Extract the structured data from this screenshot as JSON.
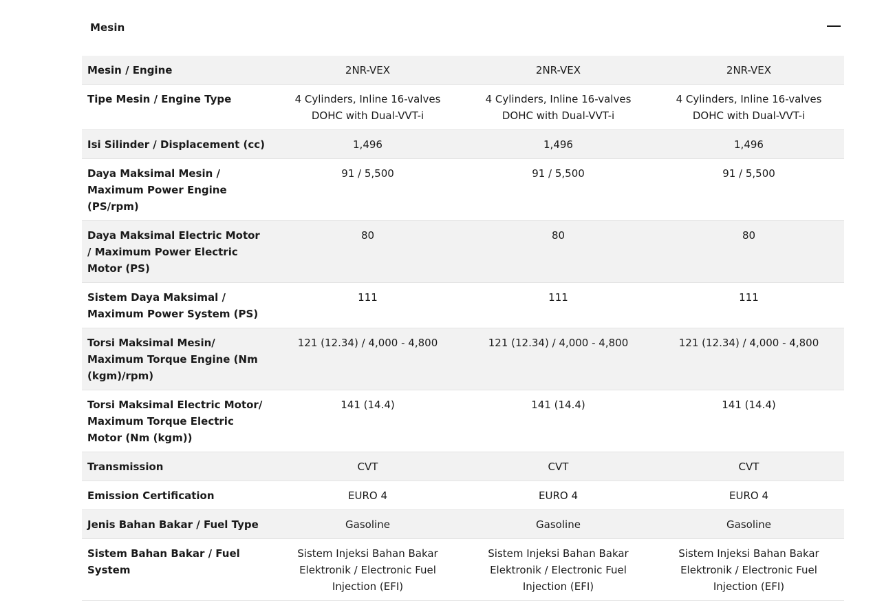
{
  "section": {
    "title": "Mesin",
    "toggle_icon": "minus-icon"
  },
  "rows": [
    {
      "label": "Mesin / Engine",
      "values": [
        "2NR-VEX",
        "2NR-VEX",
        "2NR-VEX"
      ]
    },
    {
      "label": "Tipe Mesin / Engine Type",
      "values": [
        "4 Cylinders, Inline 16-valves DOHC with Dual-VVT-i",
        "4 Cylinders, Inline 16-valves DOHC with Dual-VVT-i",
        "4 Cylinders, Inline 16-valves DOHC with Dual-VVT-i"
      ]
    },
    {
      "label": "Isi Silinder / Displacement (cc)",
      "values": [
        "1,496",
        "1,496",
        "1,496"
      ]
    },
    {
      "label": "Daya Maksimal Mesin / Maximum Power Engine (PS/rpm)",
      "values": [
        "91 / 5,500",
        "91 / 5,500",
        "91 / 5,500"
      ]
    },
    {
      "label": "Daya Maksimal Electric Motor / Maximum Power Electric Motor (PS)",
      "values": [
        "80",
        "80",
        "80"
      ]
    },
    {
      "label": "Sistem Daya Maksimal / Maximum Power System (PS)",
      "values": [
        "111",
        "111",
        "111"
      ]
    },
    {
      "label": "Torsi Maksimal Mesin/ Maximum Torque Engine (Nm (kgm)/rpm)",
      "values": [
        "121 (12.34) / 4,000 - 4,800",
        "121 (12.34) / 4,000 - 4,800",
        "121 (12.34) / 4,000 - 4,800"
      ]
    },
    {
      "label": "Torsi Maksimal Electric Motor/ Maximum Torque Electric Motor (Nm (kgm))",
      "values": [
        "141 (14.4)",
        "141 (14.4)",
        "141 (14.4)"
      ]
    },
    {
      "label": "Transmission",
      "values": [
        "CVT",
        "CVT",
        "CVT"
      ]
    },
    {
      "label": "Emission Certification",
      "values": [
        "EURO 4",
        "EURO 4",
        "EURO 4"
      ]
    },
    {
      "label": "Jenis Bahan Bakar / Fuel Type",
      "values": [
        "Gasoline",
        "Gasoline",
        "Gasoline"
      ]
    },
    {
      "label": "Sistem Bahan Bakar / Fuel System",
      "values": [
        "Sistem Injeksi Bahan Bakar Elektronik / Electronic Fuel Injection (EFI)",
        "Sistem Injeksi Bahan Bakar Elektronik / Electronic Fuel Injection (EFI)",
        "Sistem Injeksi Bahan Bakar Elektronik / Electronic Fuel Injection (EFI)"
      ]
    }
  ]
}
